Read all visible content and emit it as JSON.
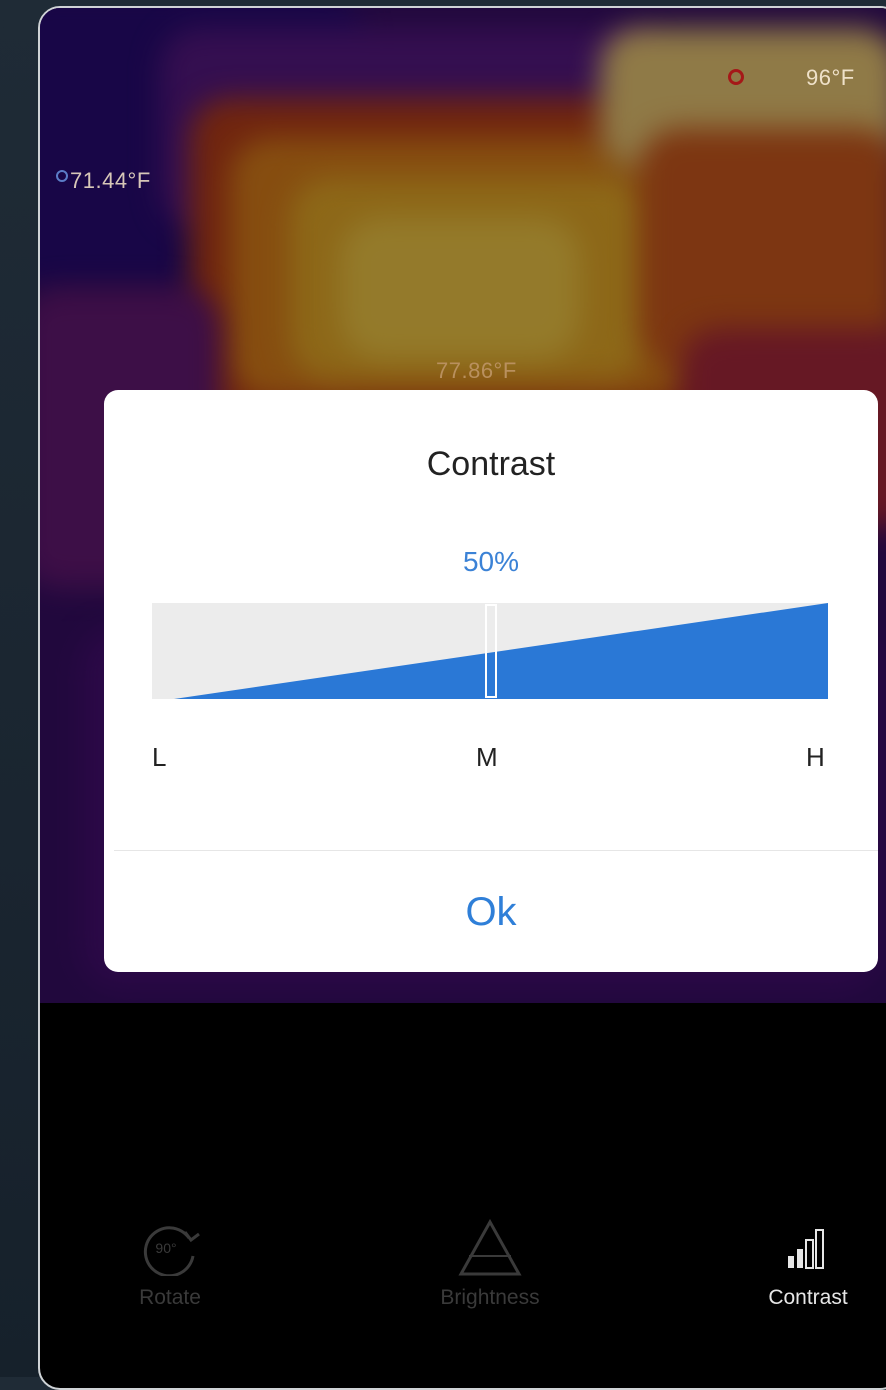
{
  "measurements": {
    "left_temp": "71.44°F",
    "center_temp": "77.86°F",
    "top_right_temp": "96°F"
  },
  "dialog": {
    "title": "Contrast",
    "value_text": "50%",
    "value_fraction": 0.5,
    "scale_labels": {
      "low": "L",
      "mid": "M",
      "high": "H"
    },
    "ok_label": "Ok"
  },
  "toolbar": {
    "items": [
      {
        "label": "Rotate",
        "icon": "rotate-90-icon",
        "active": false
      },
      {
        "label": "Brightness",
        "icon": "brightness-triangle-icon",
        "active": false
      },
      {
        "label": "Contrast",
        "icon": "contrast-bars-icon",
        "active": true
      }
    ],
    "rotate_icon_text": "90°"
  },
  "colors": {
    "accent": "#2f7fd8",
    "slider_fill": "#2a78d6",
    "slider_track": "#ececec",
    "toolbar_inactive": "#3a3a3a",
    "toolbar_active": "#e6e6e6"
  }
}
